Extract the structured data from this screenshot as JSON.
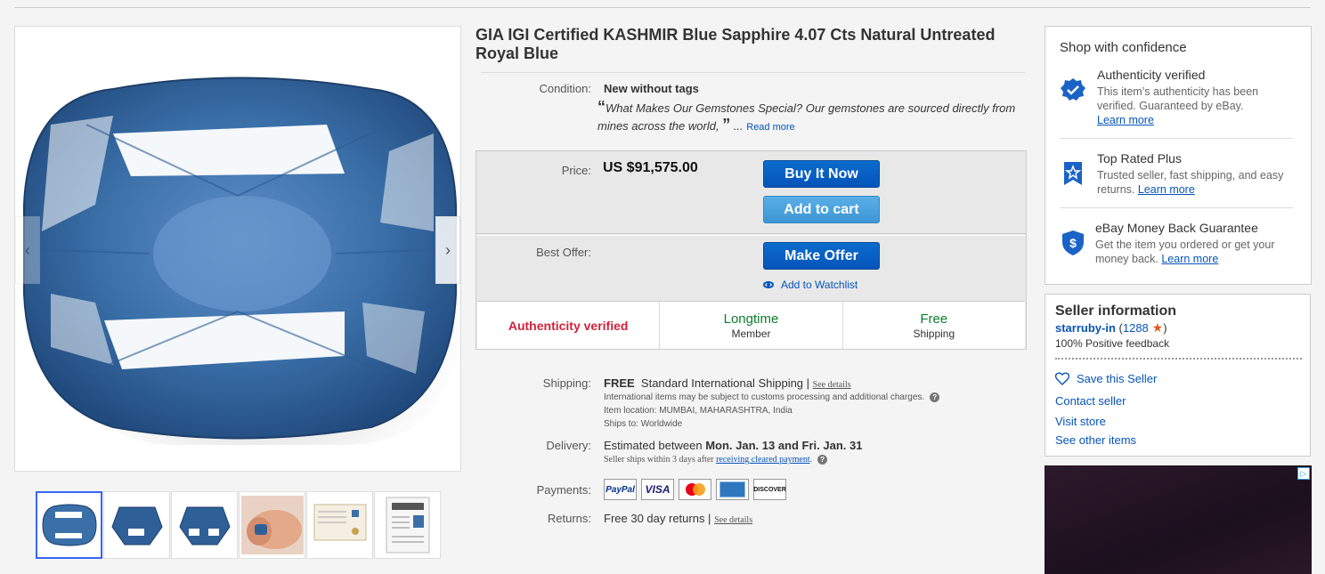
{
  "listing": {
    "title": "GIA IGI Certified KASHMIR Blue Sapphire 4.07 Cts Natural Untreated Royal Blue",
    "condition_label": "Condition:",
    "condition_value": "New without tags",
    "description_open_quote": "“",
    "description": "What Makes Our Gemstones Special? Our gemstones are sourced directly from mines across the world,",
    "description_close_quote": "”",
    "description_ellipsis": " ... ",
    "read_more": "Read more"
  },
  "gallery": {
    "prev_arrow": "‹",
    "next_arrow": "›",
    "thumbnails": [
      "sapphire-top",
      "sapphire-angle-1",
      "sapphire-angle-2",
      "sapphire-in-hand",
      "certificate-1",
      "certificate-2"
    ]
  },
  "buybox": {
    "price_label": "Price:",
    "price_value": "US $91,575.00",
    "buy_now": "Buy It Now",
    "add_to_cart": "Add to cart",
    "best_offer_label": "Best Offer:",
    "make_offer": "Make Offer",
    "watchlist": "Add to Watchlist",
    "badges": {
      "authenticity": "Authenticity verified",
      "longtime_big": "Longtime",
      "longtime_small": "Member",
      "free_big": "Free",
      "free_small": "Shipping"
    }
  },
  "shipping": {
    "label": "Shipping:",
    "free": "FREE",
    "method": "Standard International Shipping |",
    "see_details": "See details",
    "customs_note": "International items may be subject to customs processing and additional charges.",
    "location": "Item location:  MUMBAI, MAHARASHTRA, India",
    "ships_to": "Ships to:  Worldwide"
  },
  "delivery": {
    "label": "Delivery:",
    "prefix": "Estimated between ",
    "dates": "Mon. Jan. 13 and Fri. Jan. 31",
    "note_prefix": "Seller ships within 3 days after ",
    "note_link": "receiving cleared payment",
    "note_suffix": "."
  },
  "payments": {
    "label": "Payments:",
    "methods": [
      "PayPal",
      "VISA",
      "Mastercard",
      "American Express",
      "DISCOVER"
    ]
  },
  "returns": {
    "label": "Returns:",
    "value": "Free 30 day returns |",
    "see_details": "See details"
  },
  "confidence": {
    "title": "Shop with confidence",
    "items": [
      {
        "title": "Authenticity verified",
        "desc": "This item’s authenticity has been verified. Guaranteed by eBay.",
        "link": "Learn more"
      },
      {
        "title": "Top Rated Plus",
        "desc": "Trusted seller, fast shipping, and easy returns.",
        "link": "Learn more"
      },
      {
        "title": "eBay Money Back Guarantee",
        "desc": "Get the item you ordered or get your money back.",
        "link": "Learn more"
      }
    ]
  },
  "seller": {
    "title": "Seller information",
    "name": "starruby-in",
    "feedback_count": "1288",
    "feedback_pct": "100% Positive feedback",
    "save": "Save this Seller",
    "contact": "Contact seller",
    "visit": "Visit store",
    "other": "See other items"
  },
  "ad": {
    "badge": "▷"
  },
  "colors": {
    "ebay_blue": "#0654ba",
    "auth_red": "#d0233b",
    "green": "#0c7d2e",
    "gem_blue": "#3a6fa8"
  }
}
